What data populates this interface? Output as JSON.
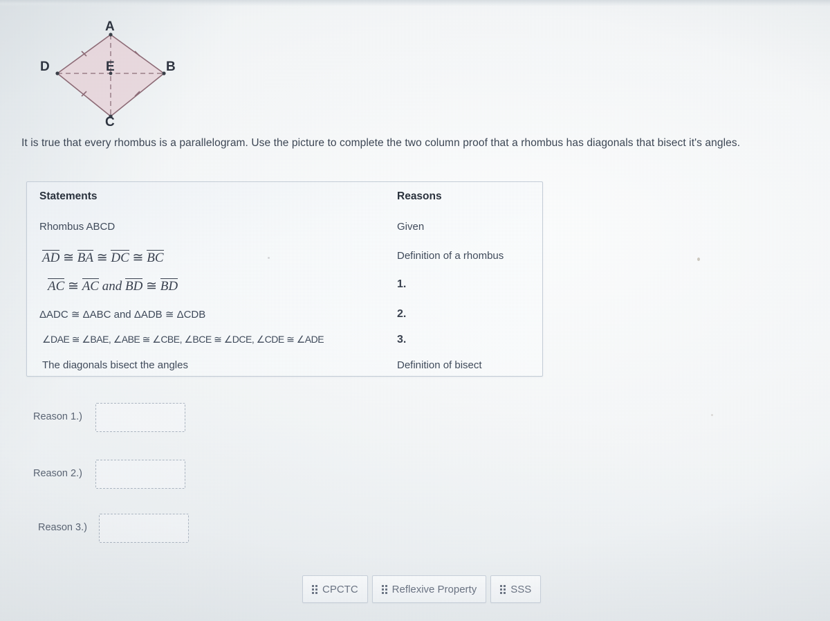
{
  "figure": {
    "name": "rhombus-abcd-diagram",
    "vertices": [
      {
        "label": "A",
        "role": "top-vertex"
      },
      {
        "label": "B",
        "role": "right-vertex"
      },
      {
        "label": "C",
        "role": "bottom-vertex"
      },
      {
        "label": "D",
        "role": "left-vertex"
      },
      {
        "label": "E",
        "role": "diagonal-intersection"
      }
    ],
    "fill_color": "#e7d6da",
    "edge_color": "#8d6b76",
    "diagonal_color": "#9a7f88",
    "diagonals_style": "dashed",
    "tick_marks": "single tick on each of the four sides"
  },
  "prompt": {
    "text": "It is true that every rhombus is a parallelogram. Use the picture to complete the two column proof that a rhombus has diagonals that bisect it's angles."
  },
  "proof_table": {
    "headers": {
      "statements": "Statements",
      "reasons": "Reasons"
    },
    "rows": [
      {
        "statement": "Rhombus ABCD",
        "statement_style": "plain",
        "reason": "Given",
        "reason_style": "plain"
      },
      {
        "statement": "AD ≅ BA ≅ DC ≅ BC",
        "statement_style": "math",
        "statement_parts": [
          {
            "overline": "AD"
          },
          {
            "sym": "≅"
          },
          {
            "overline": "BA"
          },
          {
            "sym": "≅"
          },
          {
            "overline": "DC"
          },
          {
            "sym": "≅"
          },
          {
            "overline": "BC"
          }
        ],
        "reason": "Definition of a rhombus",
        "reason_style": "plain"
      },
      {
        "statement": "AC ≅ AC and BD ≅ BD",
        "statement_style": "math",
        "statement_parts": [
          {
            "overline": "AC"
          },
          {
            "sym": "≅"
          },
          {
            "overline": "AC"
          },
          {
            "word": "and"
          },
          {
            "overline": "BD"
          },
          {
            "sym": "≅"
          },
          {
            "overline": "BD"
          }
        ],
        "reason": "1.",
        "reason_style": "number"
      },
      {
        "statement": "ΔADC ≅ ΔABC and ΔADB ≅ ΔCDB",
        "statement_style": "plain",
        "reason": "2.",
        "reason_style": "number"
      },
      {
        "statement": "∠DAE ≅ ∠BAE, ∠ABE ≅ ∠CBE, ∠BCE ≅ ∠DCE, ∠CDE ≅ ∠ADE",
        "statement_style": "plain",
        "reason": "3.",
        "reason_style": "number"
      },
      {
        "statement": "The diagonals bisect the angles",
        "statement_style": "plain",
        "reason": "Definition of bisect",
        "reason_style": "plain"
      }
    ]
  },
  "drop_zones": [
    {
      "label": "Reason 1.)",
      "value": "",
      "placeholder": ""
    },
    {
      "label": "Reason 2.)",
      "value": "",
      "placeholder": ""
    },
    {
      "label": "Reason 3.)",
      "value": "",
      "placeholder": ""
    }
  ],
  "answer_tray": {
    "chips": [
      {
        "label": "CPCTC",
        "handle_icon": "drag-handle-icon"
      },
      {
        "label": "Reflexive Property",
        "handle_icon": "drag-handle-icon"
      },
      {
        "label": "SSS",
        "handle_icon": "drag-handle-icon"
      }
    ]
  },
  "colors": {
    "page_background": "#f2f5f7",
    "table_border": "#c3ccd6",
    "text_primary": "#3f4a5a",
    "text_muted": "#6a7382",
    "dashed_border": "#aab4c0"
  }
}
